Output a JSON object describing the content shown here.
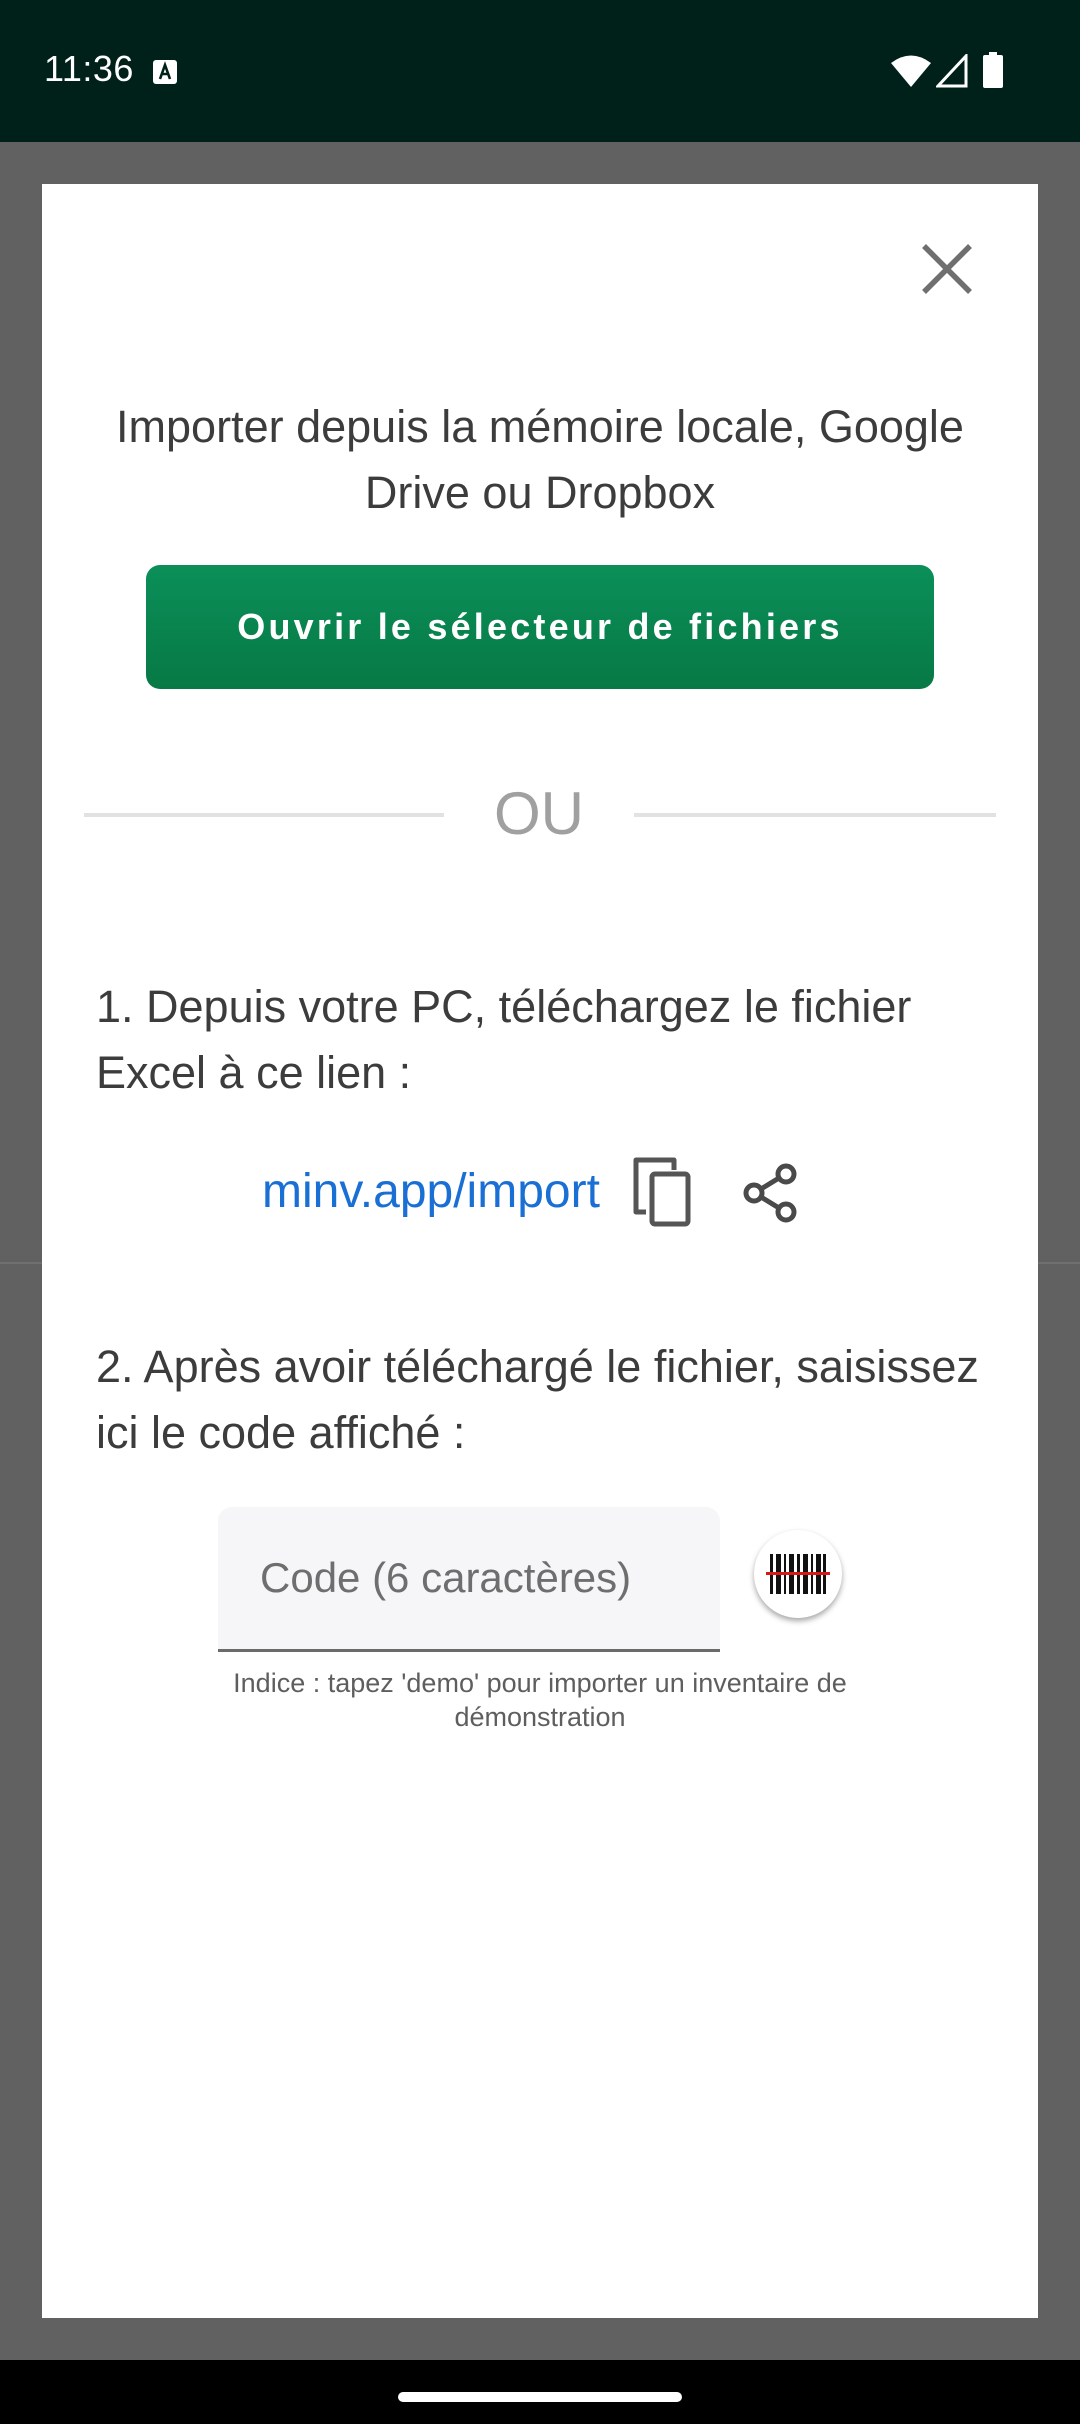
{
  "status_bar": {
    "time": "11:36",
    "icons": [
      "text-a-icon",
      "wifi-icon",
      "signal-icon",
      "battery-icon"
    ]
  },
  "dialog": {
    "close_icon": "close-icon",
    "title": "Importer depuis la mémoire locale, Google Drive ou Dropbox",
    "file_picker_button": "Ouvrir le sélecteur de fichiers",
    "divider_text": "OU",
    "step1_text": "1. Depuis votre PC, téléchargez le fichier Excel à ce lien :",
    "link_text": "minv.app/import",
    "link_icons": [
      "copy-icon",
      "share-icon"
    ],
    "step2_text": "2. Après avoir téléchargé le fichier, saisissez ici le code affiché :",
    "code_input": {
      "value": "",
      "placeholder": "Code (6 caractères)"
    },
    "scan_icon": "barcode-scan-icon",
    "hint": "Indice : tapez 'demo' pour importer un inventaire de démonstration"
  },
  "colors": {
    "status_bar": "#00211a",
    "primary_button": "#077945",
    "link": "#1a6fd4",
    "backdrop": "#616161"
  }
}
